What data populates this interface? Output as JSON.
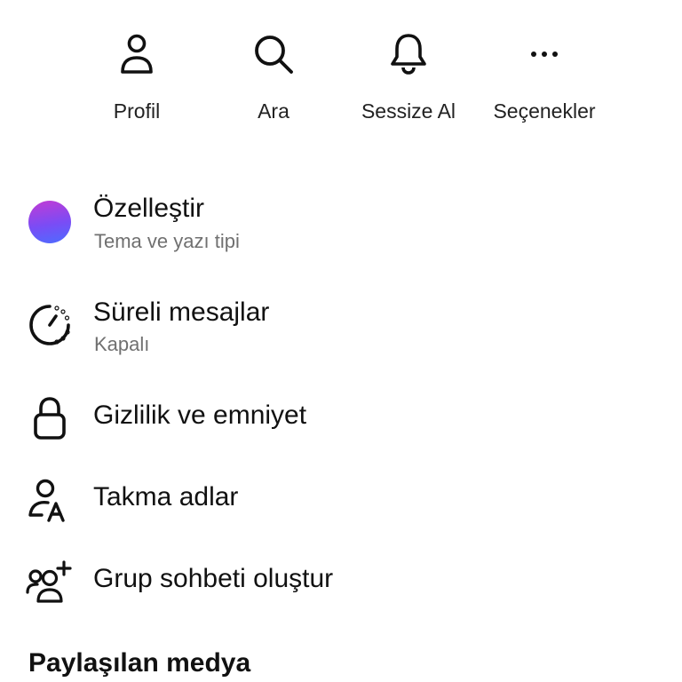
{
  "quick_actions": [
    {
      "label": "Profil",
      "icon": "person-icon"
    },
    {
      "label": "Ara",
      "icon": "search-icon"
    },
    {
      "label": "Sessize Al",
      "icon": "bell-icon"
    },
    {
      "label": "Seçenekler",
      "icon": "more-dots-icon"
    }
  ],
  "settings": {
    "customize": {
      "title": "Özelleştir",
      "subtitle": "Tema ve yazı tipi",
      "icon": "theme-swatch-icon"
    },
    "disappearing": {
      "title": "Süreli mesajlar",
      "subtitle": "Kapalı",
      "icon": "timer-icon"
    },
    "privacy": {
      "title": "Gizlilik ve emniyet",
      "icon": "lock-icon"
    },
    "nicknames": {
      "title": "Takma adlar",
      "icon": "nickname-icon"
    },
    "group": {
      "title": "Grup sohbeti oluştur",
      "icon": "add-group-icon"
    }
  },
  "section": {
    "title": "Paylaşılan medya"
  },
  "colors": {
    "swatch_start": "#c23bd4",
    "swatch_end": "#4d6cff",
    "subtitle": "#707070"
  }
}
